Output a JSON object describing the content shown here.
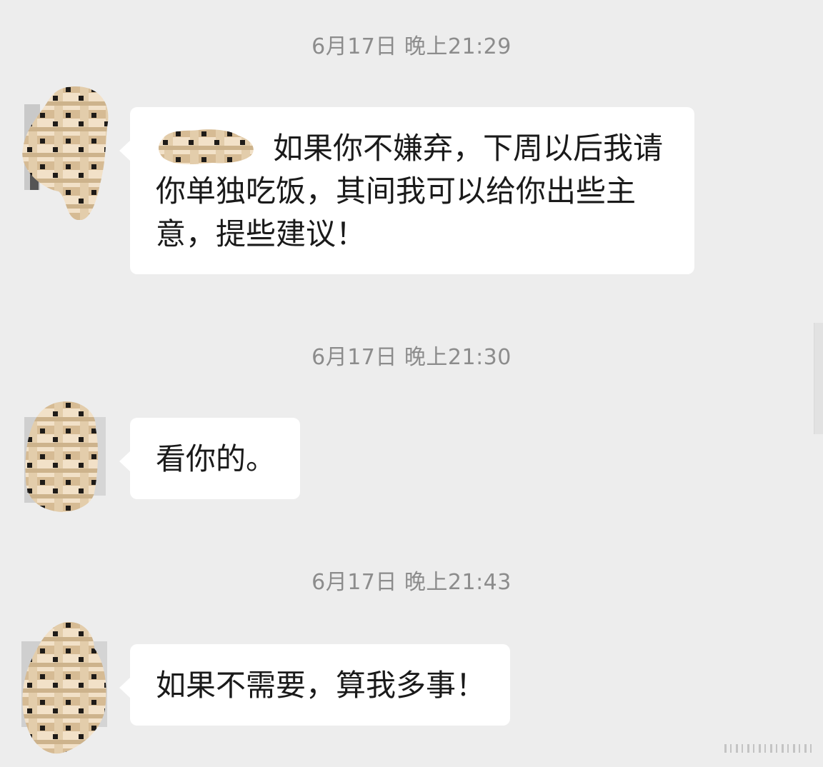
{
  "messages": [
    {
      "timestamp": "6月17日 晚上21:29",
      "text": "如果你不嫌弃，下周以后我请你单独吃饭，其间我可以给你出些主意，提些建议！"
    },
    {
      "timestamp": "6月17日 晚上21:30",
      "text": "看你的。"
    },
    {
      "timestamp": "6月17日 晚上21:43",
      "text": "如果不需要，算我多事！"
    }
  ],
  "colors": {
    "background": "#ededed",
    "bubble": "#ffffff",
    "timestamp_text": "#8c8c8c",
    "message_text": "#1a1a1a",
    "mosaic_tan": "#d9c2a0",
    "mosaic_dark": "#1e1b18"
  },
  "icons": {
    "avatar": "mosaic-avatar-icon",
    "name_redaction": "mosaic-name-icon"
  }
}
